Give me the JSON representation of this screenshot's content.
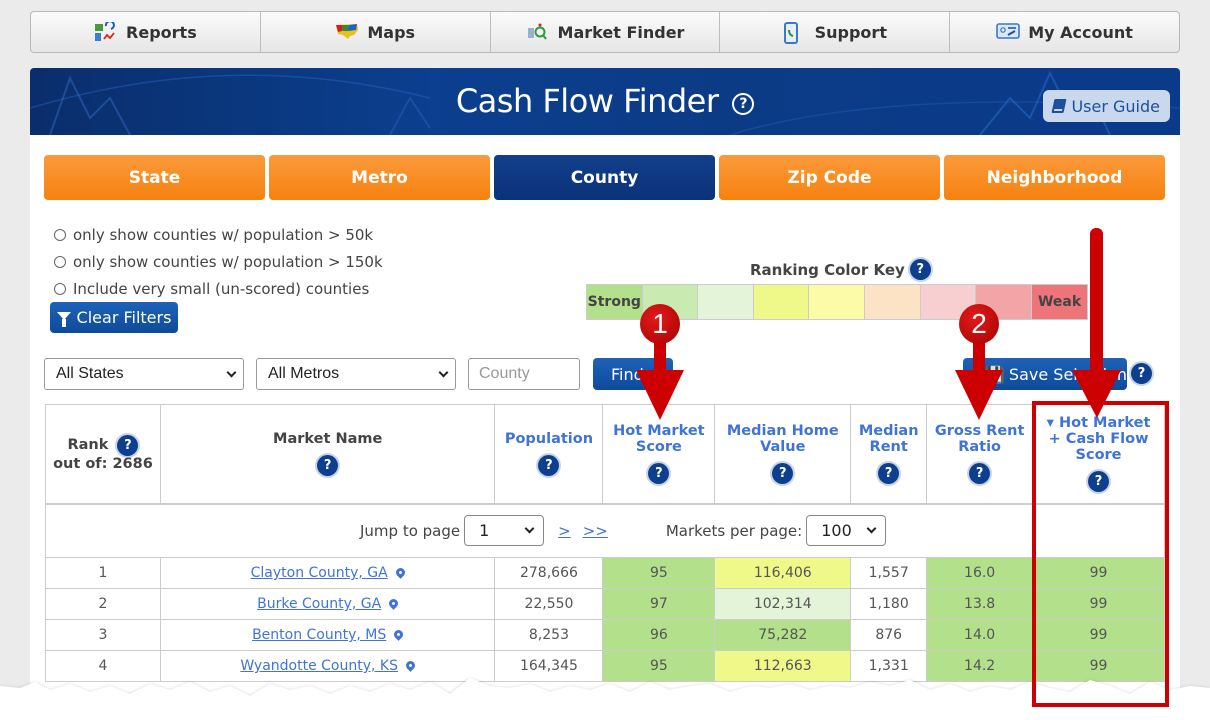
{
  "top_nav": [
    {
      "label": "Reports",
      "icon": "reports-chart-icon"
    },
    {
      "label": "Maps",
      "icon": "us-map-icon"
    },
    {
      "label": "Market Finder",
      "icon": "market-finder-search-icon"
    },
    {
      "label": "Support",
      "icon": "phone-icon"
    },
    {
      "label": "My Account",
      "icon": "account-card-icon"
    }
  ],
  "hero": {
    "title": "Cash Flow Finder",
    "help_glyph": "?",
    "user_guide_label": "User Guide"
  },
  "level_tabs": [
    {
      "label": "State",
      "active": false
    },
    {
      "label": "Metro",
      "active": false
    },
    {
      "label": "County",
      "active": true
    },
    {
      "label": "Zip Code",
      "active": false
    },
    {
      "label": "Neighborhood",
      "active": false
    }
  ],
  "filters": {
    "options": [
      "only show counties w/ population > 50k",
      "only show counties w/ population > 150k",
      "Include very small (un-scored) counties"
    ],
    "clear_label": "Clear Filters"
  },
  "color_key": {
    "title": "Ranking Color Key",
    "strong_label": "Strong",
    "weak_label": "Weak",
    "colors": [
      "#b3e08a",
      "#c9eab0",
      "#e3f4d8",
      "#eef98a",
      "#fbfba8",
      "#fde3c6",
      "#f8cfd0",
      "#f2a4a7",
      "#ed7479"
    ]
  },
  "search": {
    "state_select": "All States",
    "metro_select": "All Metros",
    "county_placeholder": "County",
    "find_label": "Find",
    "save_label": "Save Selection"
  },
  "table": {
    "headers": {
      "rank": "Rank",
      "rank_sub": "out of: 2686",
      "market_name": "Market Name",
      "population": "Population",
      "hot_market_score_1": "Hot Market",
      "hot_market_score_2": "Score",
      "median_home_value_1": "Median Home",
      "median_home_value_2": "Value",
      "median_rent_1": "Median",
      "median_rent_2": "Rent",
      "gross_rent_ratio_1": "Gross Rent",
      "gross_rent_ratio_2": "Ratio",
      "hot_cash_1": "▾ Hot Market",
      "hot_cash_2": "+ Cash Flow",
      "hot_cash_3": "Score"
    },
    "pager": {
      "jump_label": "Jump to page",
      "page": "1",
      "next": ">",
      "last": ">>",
      "per_page_label": "Markets per page:",
      "per_page": "100"
    },
    "rows": [
      {
        "rank": "1",
        "name": "Clayton County, GA",
        "population": "278,666",
        "hot_score": "95",
        "home_value": "116,406",
        "rent": "1,557",
        "grr": "16.0",
        "combined": "99"
      },
      {
        "rank": "2",
        "name": "Burke County, GA",
        "population": "22,550",
        "hot_score": "97",
        "home_value": "102,314",
        "rent": "1,180",
        "grr": "13.8",
        "combined": "99"
      },
      {
        "rank": "3",
        "name": "Benton County, MS",
        "population": "8,253",
        "hot_score": "96",
        "home_value": "75,282",
        "rent": "876",
        "grr": "14.0",
        "combined": "99"
      },
      {
        "rank": "4",
        "name": "Wyandotte County, KS",
        "population": "164,345",
        "hot_score": "95",
        "home_value": "112,663",
        "rent": "1,331",
        "grr": "14.2",
        "combined": "99"
      }
    ],
    "row_colors": [
      {
        "hot_score": "#b3e08a",
        "home_value": "#eef98a",
        "rent": "#ffffff",
        "grr": "#b3e08a",
        "combined": "#b3e08a"
      },
      {
        "hot_score": "#b3e08a",
        "home_value": "#e3f4d8",
        "rent": "#ffffff",
        "grr": "#b3e08a",
        "combined": "#b3e08a"
      },
      {
        "hot_score": "#b3e08a",
        "home_value": "#b3e08a",
        "rent": "#ffffff",
        "grr": "#b3e08a",
        "combined": "#b3e08a"
      },
      {
        "hot_score": "#b3e08a",
        "home_value": "#eef98a",
        "rent": "#ffffff",
        "grr": "#b3e08a",
        "combined": "#b3e08a"
      }
    ]
  },
  "annotations": {
    "badge_1": "1",
    "badge_2": "2",
    "accent_color": "#cc0000"
  }
}
